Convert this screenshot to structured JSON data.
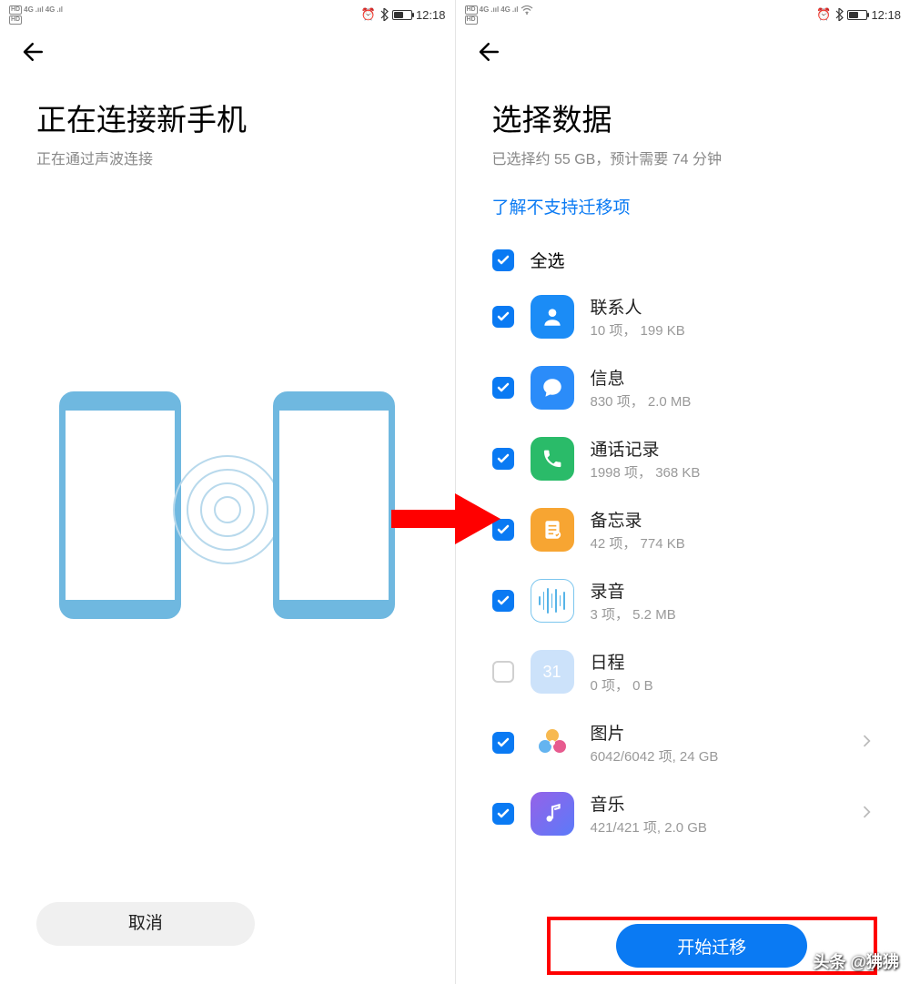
{
  "status": {
    "hd_label": "HD",
    "net_label": "4G",
    "alarm_icon": "⏰",
    "bt_icon": "bluetooth",
    "time": "12:18"
  },
  "left": {
    "title": "正在连接新手机",
    "subtitle": "正在通过声波连接",
    "cancel_label": "取消"
  },
  "right": {
    "title": "选择数据",
    "subtitle": "已选择约 55 GB，预计需要 74 分钟",
    "link": "了解不支持迁移项",
    "select_all_label": "全选",
    "start_label": "开始迁移",
    "items": [
      {
        "icon": "contacts",
        "title": "联系人",
        "sub": "10 项，  199 KB",
        "checked": true,
        "arrow": false
      },
      {
        "icon": "msg",
        "title": "信息",
        "sub": "830 项， 2.0 MB",
        "checked": true,
        "arrow": false
      },
      {
        "icon": "call",
        "title": "通话记录",
        "sub": "1998 项， 368 KB",
        "checked": true,
        "arrow": false
      },
      {
        "icon": "memo",
        "title": "备忘录",
        "sub": "42 项， 774 KB",
        "checked": true,
        "arrow": false
      },
      {
        "icon": "rec",
        "title": "录音",
        "sub": "3 项， 5.2 MB",
        "checked": true,
        "arrow": false
      },
      {
        "icon": "cal",
        "title": "日程",
        "sub": "0 项， 0 B",
        "checked": false,
        "arrow": false
      },
      {
        "icon": "photo",
        "title": "图片",
        "sub": "6042/6042 项, 24 GB",
        "checked": true,
        "arrow": true
      },
      {
        "icon": "music",
        "title": "音乐",
        "sub": "421/421 项, 2.0 GB",
        "checked": true,
        "arrow": true
      }
    ]
  },
  "watermark": "头条 @狒狒"
}
